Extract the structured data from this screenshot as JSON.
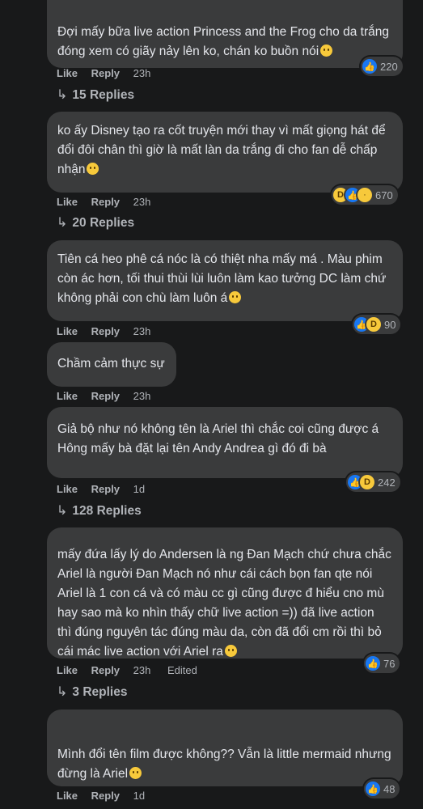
{
  "labels": {
    "like": "Like",
    "reply": "Reply",
    "edited": "Edited"
  },
  "comments": [
    {
      "text": "Đợi mấy bữa live action Princess and the Frog cho da trắng đóng xem có giãy nảy lên ko, chán ko buồn nói",
      "time": "23h",
      "reactions": [
        "like"
      ],
      "reaction_count": "220",
      "replies": "15 Replies"
    },
    {
      "text": "ko ấy Disney tạo ra cốt truyện mới thay vì mất giọng hát để đổi đôi chân thì giờ là mất làn da trắng đi cho fan dễ chấp nhận",
      "time": "23h",
      "reactions": [
        "haha",
        "like",
        "sad"
      ],
      "reaction_count": "670",
      "replies": "20 Replies"
    },
    {
      "text": "Tiên cá heo phê cá nóc là có thiệt nha mấy má . Màu phim còn ác hơn, tối thui thùi lùi luôn làm kao tưởng DC làm chứ không phải con chù làm luôn á",
      "time": "23h",
      "reactions": [
        "like",
        "haha"
      ],
      "reaction_count": "90"
    },
    {
      "text": "Chầm cảm thực sự",
      "time": "23h"
    },
    {
      "text": "Giả bộ như nó không tên là Ariel thì chắc coi cũng được á  Hông mấy bà đặt lại tên Andy Andrea gì đó đi bà",
      "time": "1d",
      "reactions": [
        "like",
        "haha"
      ],
      "reaction_count": "242",
      "replies": "128 Replies"
    },
    {
      "text": "mấy đứa lấy lý do Andersen là ng Đan Mạch chứ chưa chắc Ariel là người Đan Mạch nó  như cái cách bọn fan qte nói Ariel là 1 con cá và có màu cc gì cũng được  đ hiểu cno mù hay sao mà ko nhìn thấy chữ live action =)) đã live action thì đúng nguyên tác đúng màu da, còn đã đổi cm rồi thì bỏ cái mác live action với Ariel ra",
      "time": "23h",
      "edited": true,
      "reactions": [
        "like"
      ],
      "reaction_count": "76",
      "replies": "3 Replies"
    },
    {
      "text": "Mình đổi tên film được không?? Vẫn là little mermaid nhưng đừng là Ariel",
      "time": "1d",
      "reactions": [
        "like"
      ],
      "reaction_count": "48"
    }
  ]
}
